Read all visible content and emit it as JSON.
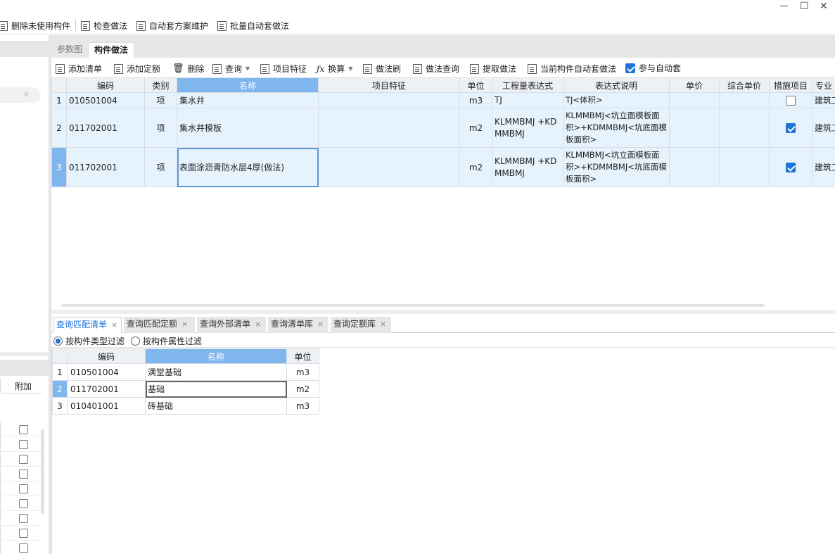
{
  "window": {
    "minimize": "—",
    "maximize": "☐",
    "close": "✕"
  },
  "top_toolbar": [
    "删除未使用构件",
    "检查做法",
    "自动套方案维护",
    "批量自动套做法"
  ],
  "main_tabs": [
    {
      "label": "参数图",
      "active": false
    },
    {
      "label": "构件做法",
      "active": true
    }
  ],
  "toolbar2": {
    "add_list": "添加清单",
    "add_quota": "添加定额",
    "delete": "删除",
    "query": "查询",
    "item_feature": "项目特征",
    "convert": "换算",
    "method_brush": "做法刷",
    "method_query": "做法查询",
    "extract_method": "提取做法",
    "auto_apply_current": "当前构件自动套做法",
    "participate_auto": "参与自动套"
  },
  "main_table": {
    "headers": [
      "编码",
      "类别",
      "名称",
      "项目特征",
      "单位",
      "工程量表达式",
      "表达式说明",
      "单价",
      "综合单价",
      "措施项目",
      "专业"
    ],
    "rows": [
      {
        "no": "1",
        "code": "010501004",
        "type": "项",
        "name": "集水井",
        "feature": "",
        "unit": "m3",
        "expr": "TJ",
        "desc": "TJ<体积>",
        "price": "",
        "total_price": "",
        "measure": false,
        "major": "建筑工程"
      },
      {
        "no": "2",
        "code": "011702001",
        "type": "项",
        "name": "集水井模板",
        "feature": "",
        "unit": "m2",
        "expr": "KLMMBMJ +KDMMBMJ",
        "desc": "KLMMBMJ<坑立面模板面积>+KDMMBMJ<坑底面模板面积>",
        "price": "",
        "total_price": "",
        "measure": true,
        "major": "建筑工程"
      },
      {
        "no": "3",
        "code": "011702001",
        "type": "项",
        "name": "表面涂沥青防水层4厚(做法)",
        "feature": "",
        "unit": "m2",
        "expr": "KLMMBMJ +KDMMBMJ",
        "desc": "KLMMBMJ<坑立面模板面积>+KDMMBMJ<坑底面模板面积>",
        "price": "",
        "total_price": "",
        "measure": true,
        "major": "建筑工程"
      }
    ]
  },
  "bottom_tabs": [
    "查询匹配清单",
    "查询匹配定额",
    "查询外部清单",
    "查询清单库",
    "查询定额库"
  ],
  "tab_close": "×",
  "filters": {
    "by_type": "按构件类型过滤",
    "by_attr": "按构件属性过滤"
  },
  "match_table": {
    "headers": [
      "编码",
      "名称",
      "单位"
    ],
    "rows": [
      {
        "no": "1",
        "code": "010501004",
        "name": "满堂基础",
        "unit": "m3"
      },
      {
        "no": "2",
        "code": "011702001",
        "name": "基础",
        "unit": "m2"
      },
      {
        "no": "3",
        "code": "010401001",
        "name": "砖基础",
        "unit": "m3"
      }
    ]
  },
  "left_panel": {
    "addon_header": "附加",
    "search_icon": "⌕"
  },
  "colors": {
    "selected_header": "#7fb6ee",
    "row_bg": "#e6f3fd",
    "accent": "#1e73d6"
  }
}
